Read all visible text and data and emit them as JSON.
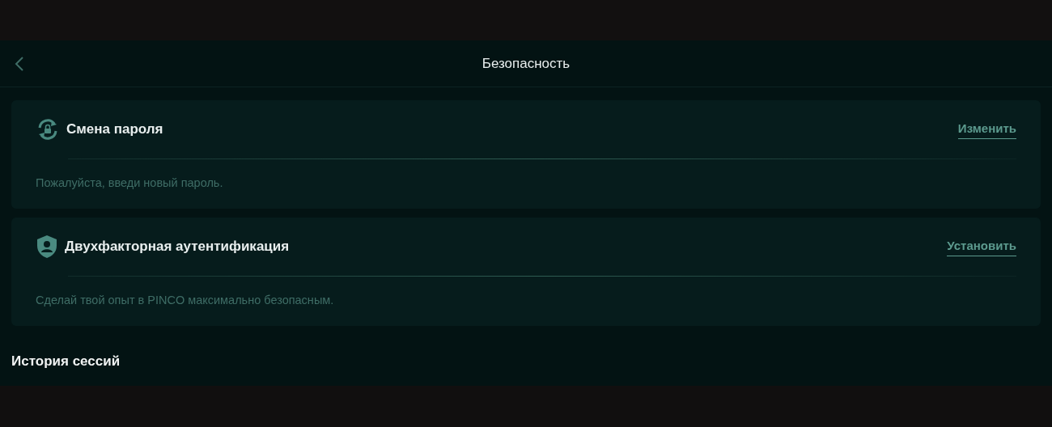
{
  "header": {
    "title": "Безопасность"
  },
  "cards": [
    {
      "kind": "password",
      "title": "Смена пароля",
      "action": "Изменить",
      "description": "Пожалуйста, введи новый пароль."
    },
    {
      "kind": "twofactor",
      "title": "Двухфакторная аутентификация",
      "action": "Установить",
      "description": "Сделай твой опыт в PINCO максимально безопасным."
    }
  ],
  "section_title": "История сессий"
}
